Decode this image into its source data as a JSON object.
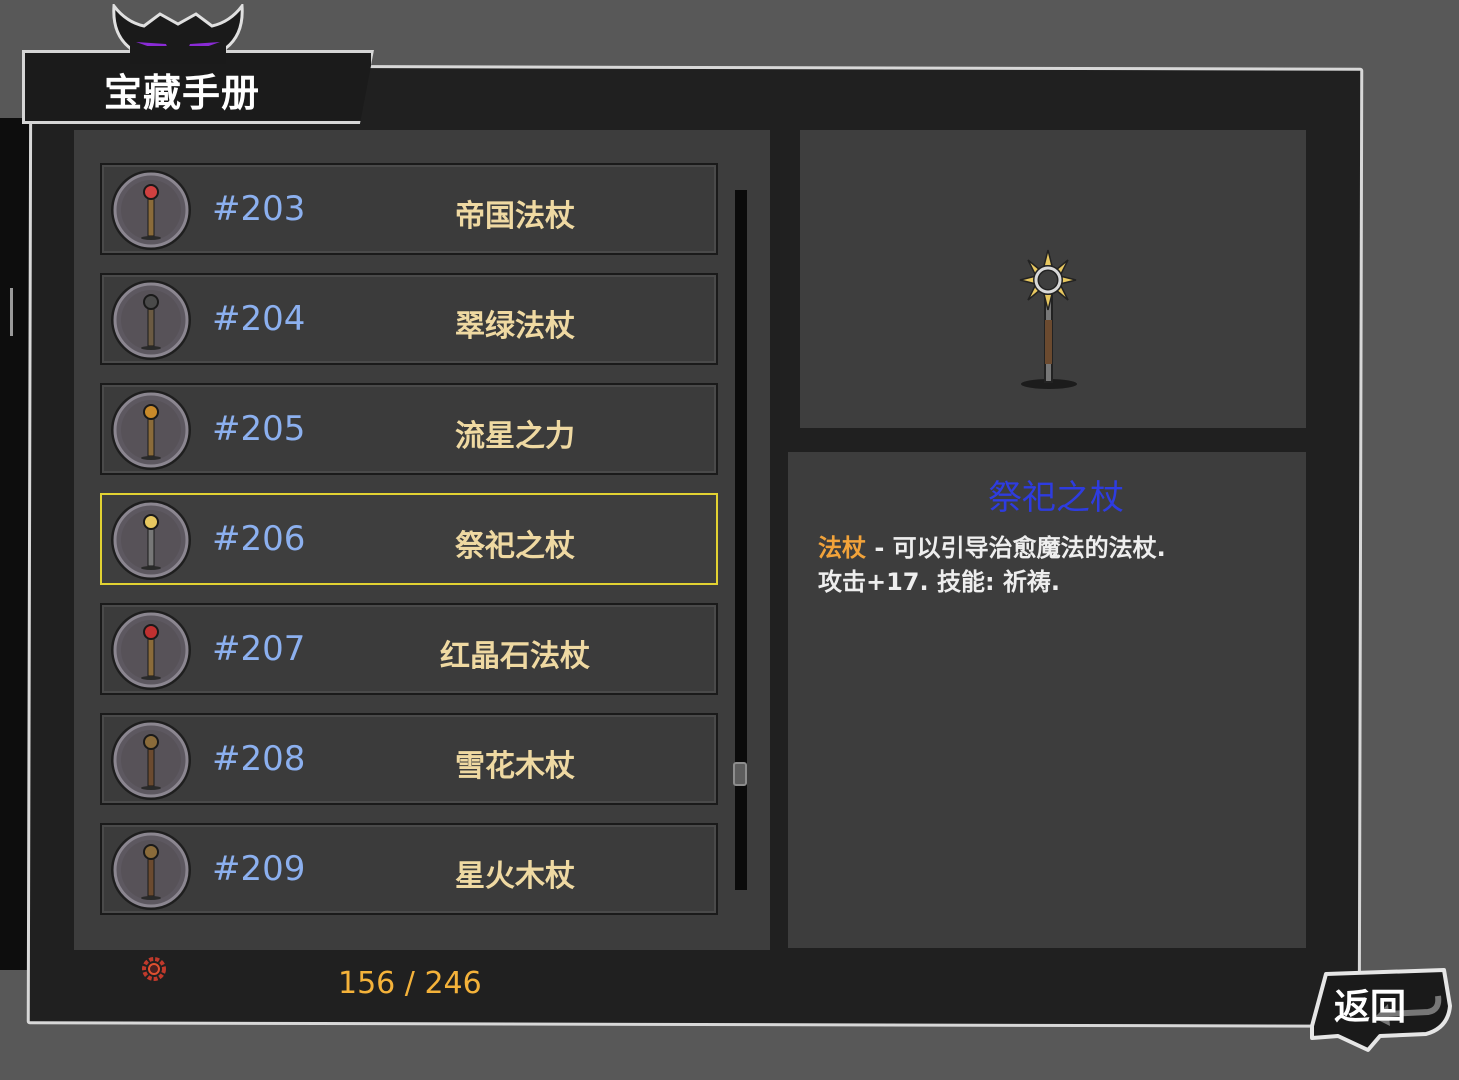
{
  "header": {
    "title": "宝藏手册"
  },
  "list": {
    "items": [
      {
        "number": "#203",
        "name": "帝国法杖",
        "icon": "imperial-staff-icon",
        "selected": false
      },
      {
        "number": "#204",
        "name": "翠绿法杖",
        "icon": "emerald-staff-icon",
        "selected": false
      },
      {
        "number": "#205",
        "name": "流星之力",
        "icon": "meteor-staff-icon",
        "selected": false
      },
      {
        "number": "#206",
        "name": "祭祀之杖",
        "icon": "ritual-staff-icon",
        "selected": true
      },
      {
        "number": "#207",
        "name": "红晶石法杖",
        "icon": "red-crystal-staff-icon",
        "selected": false
      },
      {
        "number": "#208",
        "name": "雪花木杖",
        "icon": "snowflake-wood-staff-icon",
        "selected": false
      },
      {
        "number": "#209",
        "name": "星火木杖",
        "icon": "starfire-wood-staff-icon",
        "selected": false
      }
    ]
  },
  "footer": {
    "counter": "156 / 246"
  },
  "detail": {
    "title": "祭祀之杖",
    "type_label": "法杖",
    "description": " - 可以引导治愈魔法的法杖.",
    "stats": "攻击+17. 技能: 祈祷."
  },
  "back_button": {
    "label": "返回"
  },
  "colors": {
    "selected_border": "#e2d232",
    "number_text": "#8cb0ef",
    "name_text": "#efd9a2",
    "counter_text": "#f4b23a",
    "detail_title": "#2e3ce0",
    "type_label": "#f2a33a"
  }
}
